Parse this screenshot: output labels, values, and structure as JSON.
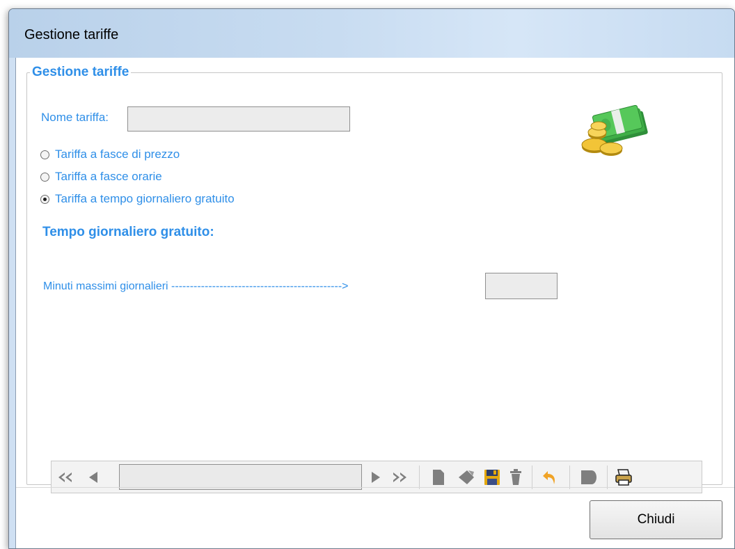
{
  "window": {
    "title": "Gestione tariffe"
  },
  "group": {
    "legend": "Gestione tariffe"
  },
  "form": {
    "name_label": "Nome tariffa:",
    "name_value": "",
    "radio_options": [
      {
        "label": "Tariffa a fasce di prezzo",
        "checked": false
      },
      {
        "label": "Tariffa a fasce orarie",
        "checked": false
      },
      {
        "label": "Tariffa a tempo giornaliero gratuito",
        "checked": true
      }
    ],
    "section_title": "Tempo giornaliero gratuito:",
    "max_minutes_label": "Minuti massimi giornalieri ---------------------------------------------->",
    "max_minutes_value": ""
  },
  "navigator": {
    "icons": [
      "first-record-icon",
      "previous-record-icon",
      "next-record-icon",
      "last-record-icon",
      "new-record-icon",
      "edit-record-icon",
      "save-record-icon",
      "delete-record-icon",
      "undo-icon",
      "cancel-icon",
      "print-icon"
    ]
  },
  "buttons": {
    "close_label": "Chiudi"
  },
  "colors": {
    "accent": "#2f8fe8",
    "title_bar": "#c8dcf1",
    "field_bg": "#ececec"
  }
}
